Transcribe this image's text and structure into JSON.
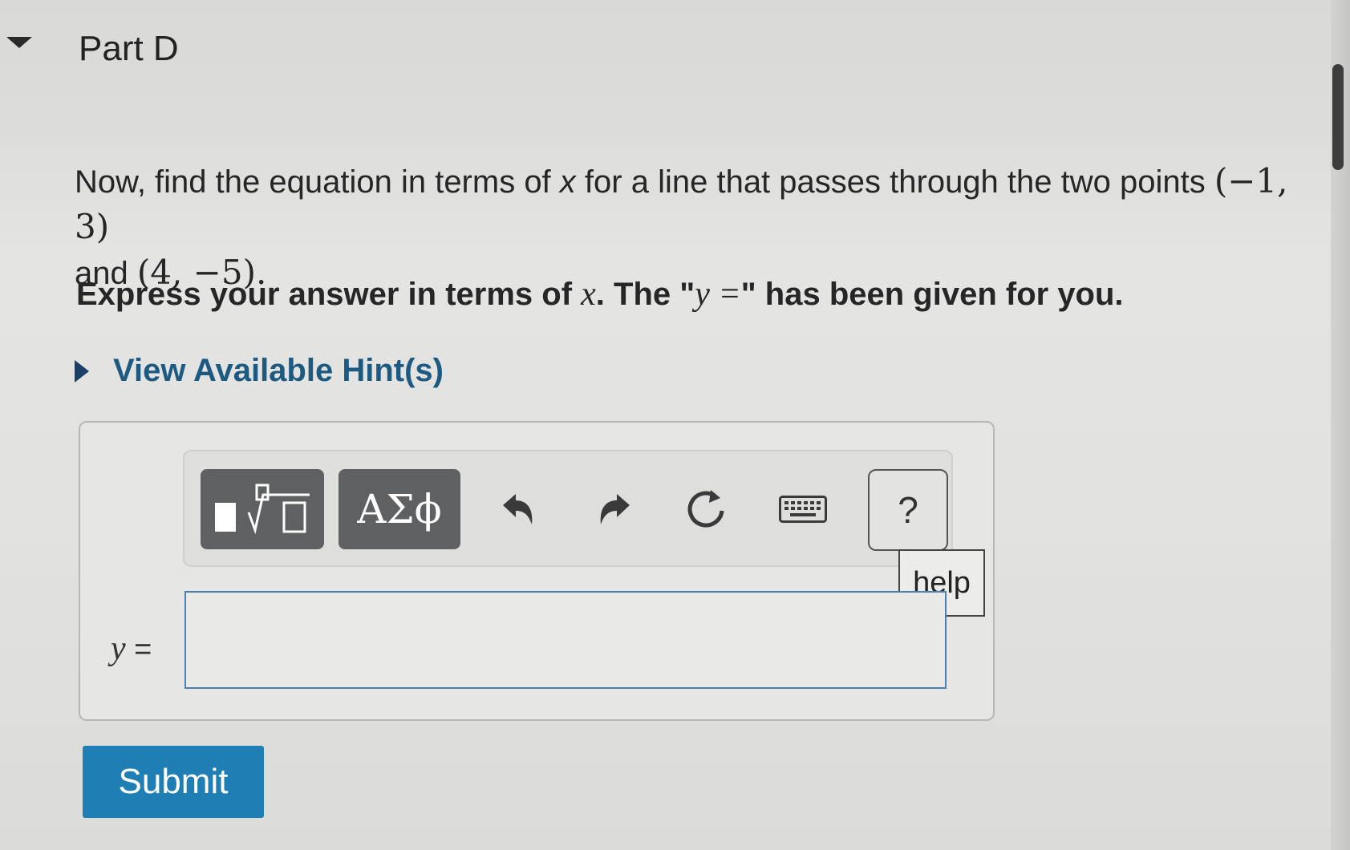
{
  "part": {
    "title": "Part D"
  },
  "question": {
    "lead": "Now, find the equation in terms of",
    "var": "x",
    "mid": "for a line that passes through the two points",
    "point1": "(−1, 3)",
    "and": "and",
    "point2": "(4, −5)",
    "end": "."
  },
  "instruction": {
    "lead": "Express your answer in terms of",
    "var": "x",
    "mid": ". The \"",
    "math": "y =",
    "end": "\" has been given for you."
  },
  "hints": {
    "label": "View Available Hint(s)"
  },
  "toolbar": {
    "symbols_label": "ΑΣϕ",
    "help_label": "?",
    "icons": [
      "templates-icon",
      "undo-icon",
      "redo-icon",
      "reset-icon",
      "keyboard-icon"
    ]
  },
  "help_tooltip": "help",
  "answer": {
    "prefix_var": "y",
    "prefix_eq": "=",
    "value": ""
  },
  "submit": {
    "label": "Submit"
  },
  "colors": {
    "accent": "#1f7fb4",
    "hint_link": "#1d5a82",
    "toolbar_button": "#5f6062"
  }
}
